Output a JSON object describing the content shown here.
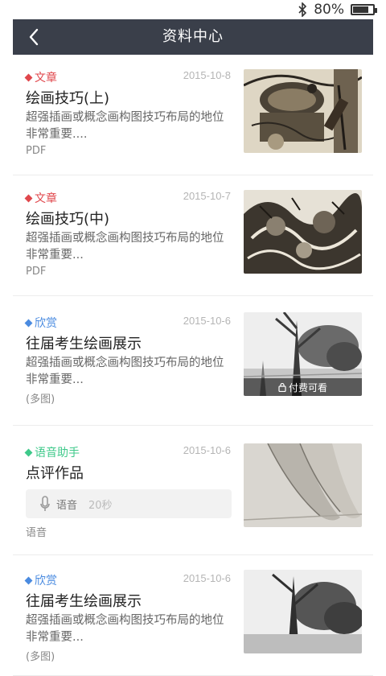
{
  "status": {
    "battery_text": "80%",
    "battery_level": 0.8
  },
  "header": {
    "title": "资料中心"
  },
  "colors": {
    "article": "#e0474c",
    "appreciate": "#4a8be0",
    "voice": "#3ec98a",
    "navbar": "#3a3f4a"
  },
  "items": [
    {
      "tag": "文章",
      "tag_kind": "article",
      "date": "2015-10-8",
      "title": "绘画技巧(上)",
      "desc": "超强插画或概念画构图技巧布局的地位非常重要....",
      "type": "PDF",
      "thumbnail": "ink-drawing-barrels"
    },
    {
      "tag": "文章",
      "tag_kind": "article",
      "date": "2015-10-7",
      "title": "绘画技巧(中)",
      "desc": "超强插画或概念画构图技巧布局的地位非常重要...",
      "type": "PDF",
      "thumbnail": "ink-drawing-creatures"
    },
    {
      "tag": "欣赏",
      "tag_kind": "appreciate",
      "date": "2015-10-6",
      "title": "往届考生绘画展示",
      "desc": "超强插画或概念画构图技巧布局的地位非常重要...",
      "type": "(多图)",
      "thumbnail": "pencil-trees",
      "paid_label": "付费可看"
    },
    {
      "tag": "语音助手",
      "tag_kind": "voice",
      "date": "2015-10-6",
      "title": "点评作品",
      "voice_label": "语音",
      "voice_duration": "20秒",
      "type": "语音",
      "thumbnail": "pencil-ballet-shoes"
    },
    {
      "tag": "欣赏",
      "tag_kind": "appreciate",
      "date": "2015-10-6",
      "title": "往届考生绘画展示",
      "desc": "超强插画或概念画构图技巧布局的地位非常重要...",
      "type": "(多图)",
      "thumbnail": "pencil-trees"
    }
  ]
}
